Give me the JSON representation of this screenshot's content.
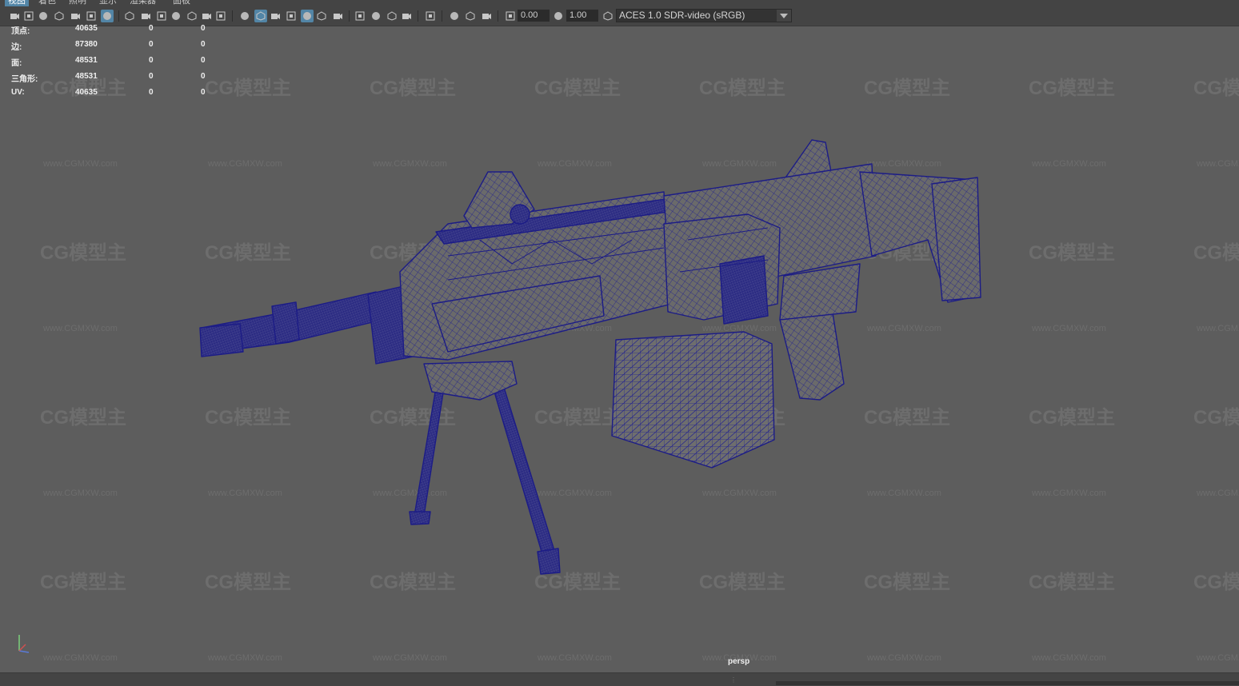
{
  "menu": {
    "items": [
      "视图",
      "着色",
      "照明",
      "显示",
      "渲染器",
      "面板"
    ],
    "active_index": 0
  },
  "toolbar": {
    "icons": [
      "camera-icon",
      "camera-lock-icon",
      "camera-attributes-icon",
      "bookmark-icon",
      "image-plane-icon",
      "2d-pan-zoom-icon",
      "grease-pencil-icon",
      "grid-icon",
      "film-gate-icon",
      "resolution-gate-icon",
      "gate-mask-icon",
      "field-chart-icon",
      "safe-action-icon",
      "safe-title-icon",
      "wireframe-icon",
      "smooth-shade-icon",
      "default-material-icon",
      "wireframe-on-shaded-icon",
      "textured-icon",
      "use-all-lights-icon",
      "shadows-icon",
      "screen-space-ao-icon",
      "motion-blur-icon",
      "multisample-aa-icon",
      "depth-of-field-icon",
      "isolate-select-icon",
      "xray-icon",
      "xray-joints-icon",
      "xray-components-icon",
      "exposure-icon",
      "gamma-icon",
      "color-management-icon"
    ],
    "exposure_value": "0.00",
    "gamma_value": "1.00",
    "color_transform": "ACES 1.0 SDR-video (sRGB)"
  },
  "hud": {
    "rows": [
      {
        "label": "顶点:",
        "c1": "40635",
        "c2": "0",
        "c3": "0"
      },
      {
        "label": "边:",
        "c1": "87380",
        "c2": "0",
        "c3": "0"
      },
      {
        "label": "面:",
        "c1": "48531",
        "c2": "0",
        "c3": "0"
      },
      {
        "label": "三角形:",
        "c1": "48531",
        "c2": "0",
        "c3": "0"
      },
      {
        "label": "UV:",
        "c1": "40635",
        "c2": "0",
        "c3": "0"
      }
    ]
  },
  "viewport": {
    "camera": "persp",
    "watermark_logo": "CG模型主",
    "watermark_url": "www.CGMXW.com",
    "background_color": "#5d5d5d",
    "wire_color": "#1f1f8a",
    "mesh_fill": "#6b6b6b"
  }
}
